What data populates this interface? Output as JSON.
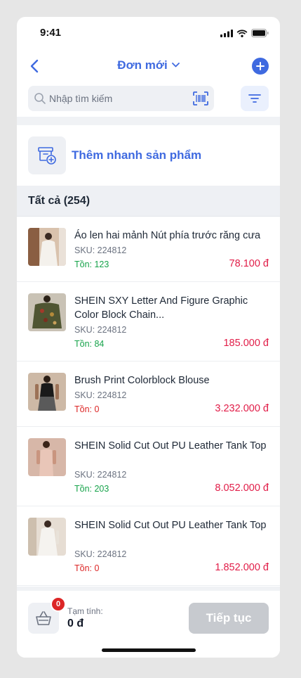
{
  "status_bar": {
    "time": "9:41"
  },
  "nav": {
    "title": "Đơn mới"
  },
  "search": {
    "placeholder": "Nhập tìm kiếm"
  },
  "quick_add": {
    "label": "Thêm nhanh sản phẩm"
  },
  "section": {
    "title": "Tất cả (254)"
  },
  "products": [
    {
      "name": "Áo len hai mảnh Nút phía trước răng cưa",
      "sku": "SKU: 224812",
      "stock": "Tồn: 123",
      "stock_status": "in",
      "price": "78.100 đ"
    },
    {
      "name": "SHEIN SXY Letter And Figure Graphic Color Block Chain...",
      "sku": "SKU: 224812",
      "stock": "Tồn: 84",
      "stock_status": "in",
      "price": "185.000 đ"
    },
    {
      "name": "Brush Print Colorblock Blouse",
      "sku": "SKU: 224812",
      "stock": "Tồn: 0",
      "stock_status": "out",
      "price": "3.232.000 đ"
    },
    {
      "name": "SHEIN Solid Cut Out PU Leather Tank Top",
      "sku": "SKU: 224812",
      "stock": "Tồn: 203",
      "stock_status": "in",
      "price": "8.052.000 đ"
    },
    {
      "name": "SHEIN Solid Cut Out PU Leather Tank Top",
      "sku": "SKU: 224812",
      "stock": "Tồn: 0",
      "stock_status": "out",
      "price": "1.852.000 đ"
    }
  ],
  "cart": {
    "badge_count": "0",
    "subtotal_label": "Tạm tính:",
    "subtotal_value": "0 đ",
    "continue_label": "Tiếp tục"
  },
  "colors": {
    "accent": "#3f6ae0",
    "price": "#e11d48",
    "in_stock": "#16a34a",
    "out_of_stock": "#dc2626"
  }
}
